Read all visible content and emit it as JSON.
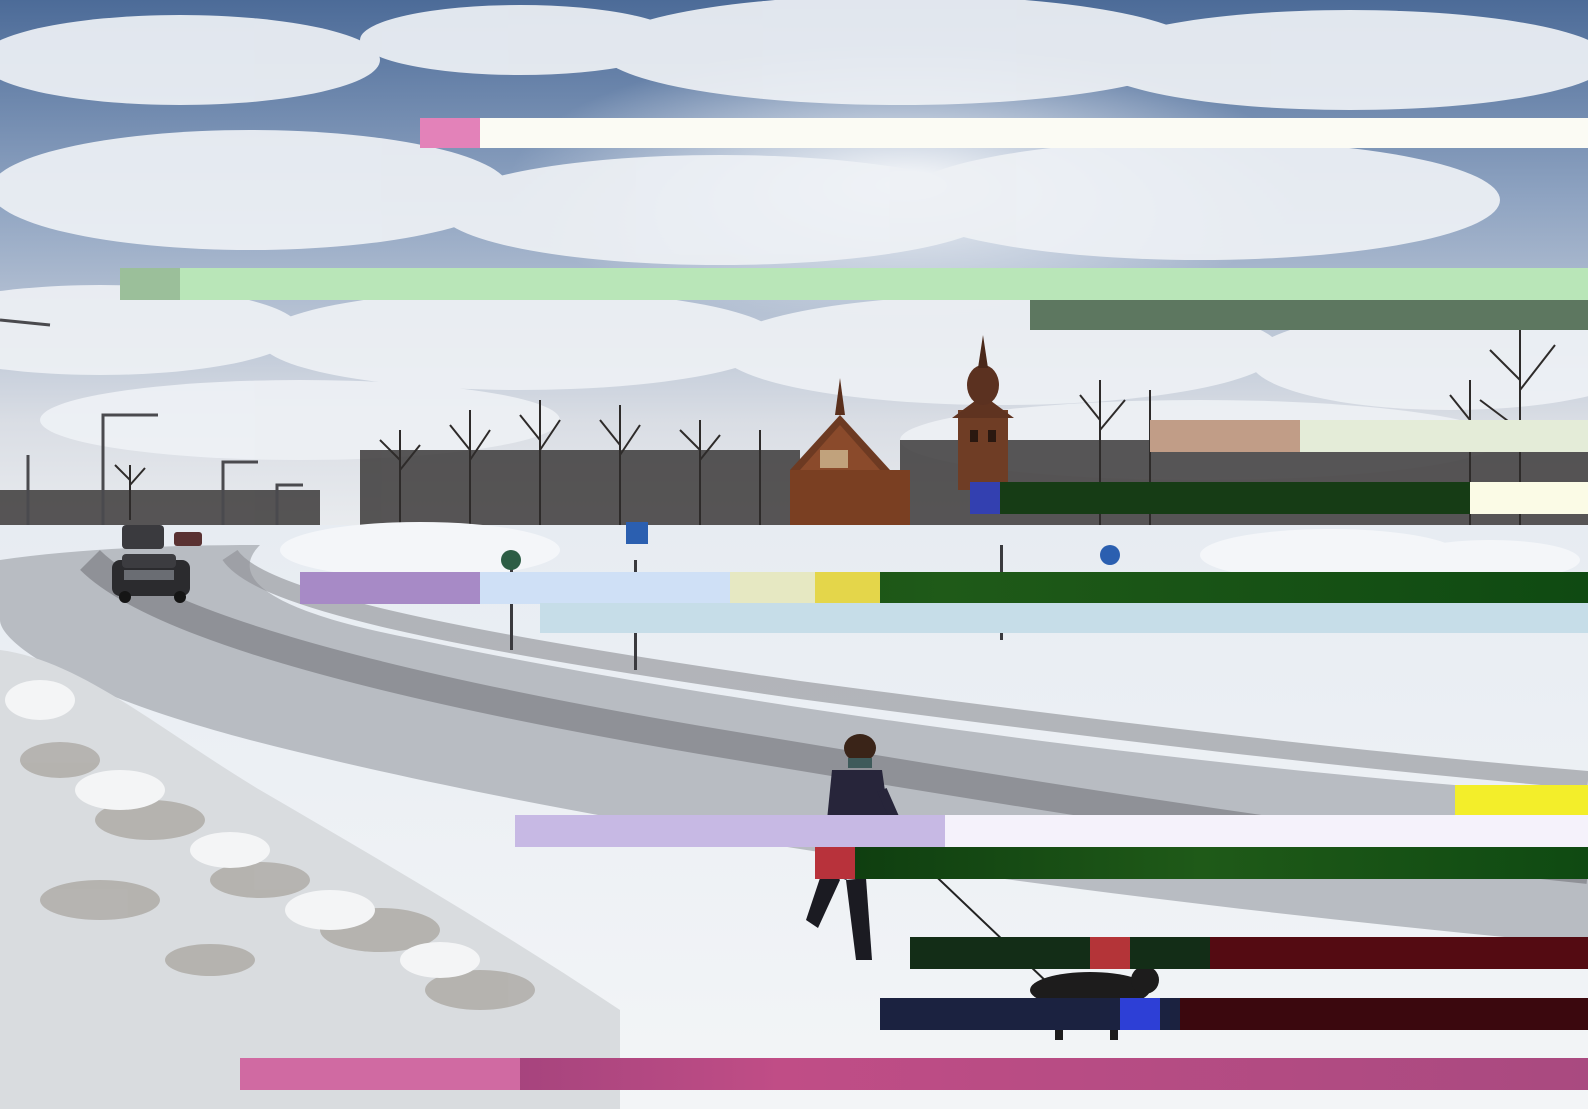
{
  "scene": {
    "description_tags": [
      "winter-town",
      "snowy-road",
      "wooden-church",
      "bell-tower",
      "pedestrian-with-dog",
      "cars"
    ],
    "colors": {
      "sky_blue": "#4f6f9e",
      "cloud": "#e8ecf2",
      "snow": "#eef2f6",
      "road": "#8e9096",
      "church_wood": "#7a3f22",
      "glitch_green": "#1f4d12",
      "glitch_magenta": "#b0457a",
      "glitch_red": "#5a0a10"
    }
  }
}
